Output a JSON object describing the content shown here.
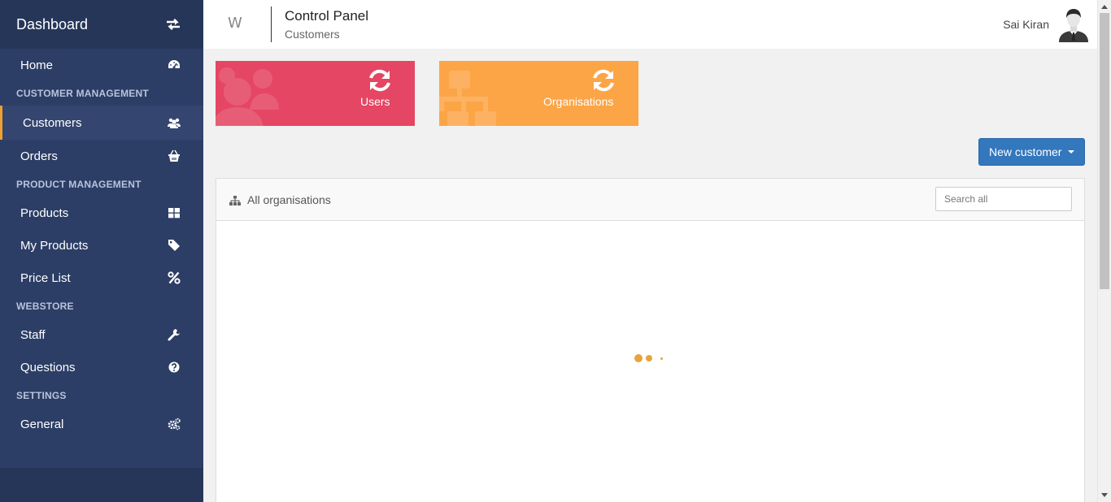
{
  "sidebar": {
    "title": "Dashboard",
    "toggle_icon": "swap-arrows-icon",
    "items": [
      {
        "type": "item",
        "label": "Home",
        "icon": "dashboard-gauge-icon"
      },
      {
        "type": "section",
        "label": "CUSTOMER MANAGEMENT"
      },
      {
        "type": "item",
        "label": "Customers",
        "icon": "users-icon",
        "active": true
      },
      {
        "type": "item",
        "label": "Orders",
        "icon": "basket-icon"
      },
      {
        "type": "section",
        "label": "PRODUCT MANAGEMENT"
      },
      {
        "type": "item",
        "label": "Products",
        "icon": "grid-icon"
      },
      {
        "type": "item",
        "label": "My Products",
        "icon": "tag-icon"
      },
      {
        "type": "item",
        "label": "Price List",
        "icon": "percent-icon"
      },
      {
        "type": "section",
        "label": "WEBSTORE"
      },
      {
        "type": "item",
        "label": "Staff",
        "icon": "wrench-icon"
      },
      {
        "type": "item",
        "label": "Questions",
        "icon": "question-circle-icon"
      },
      {
        "type": "section",
        "label": "SETTINGS"
      },
      {
        "type": "item",
        "label": "General",
        "icon": "cogs-icon"
      }
    ]
  },
  "header": {
    "logo": "W",
    "title": "Control Panel",
    "subtitle": "Customers",
    "user_name": "Sai Kiran"
  },
  "tiles": [
    {
      "label": "Users",
      "color": "#e54663",
      "icon": "refresh-icon"
    },
    {
      "label": "Organisations",
      "color": "#fca546",
      "icon": "refresh-icon"
    }
  ],
  "actions": {
    "new_customer_label": "New customer"
  },
  "panel": {
    "title": "All organisations",
    "search_placeholder": "Search all"
  },
  "colors": {
    "sidebar_bg": "#2c3e66",
    "accent": "#f0a030",
    "primary_button": "#3377bd",
    "loader": "#e8a33d"
  }
}
